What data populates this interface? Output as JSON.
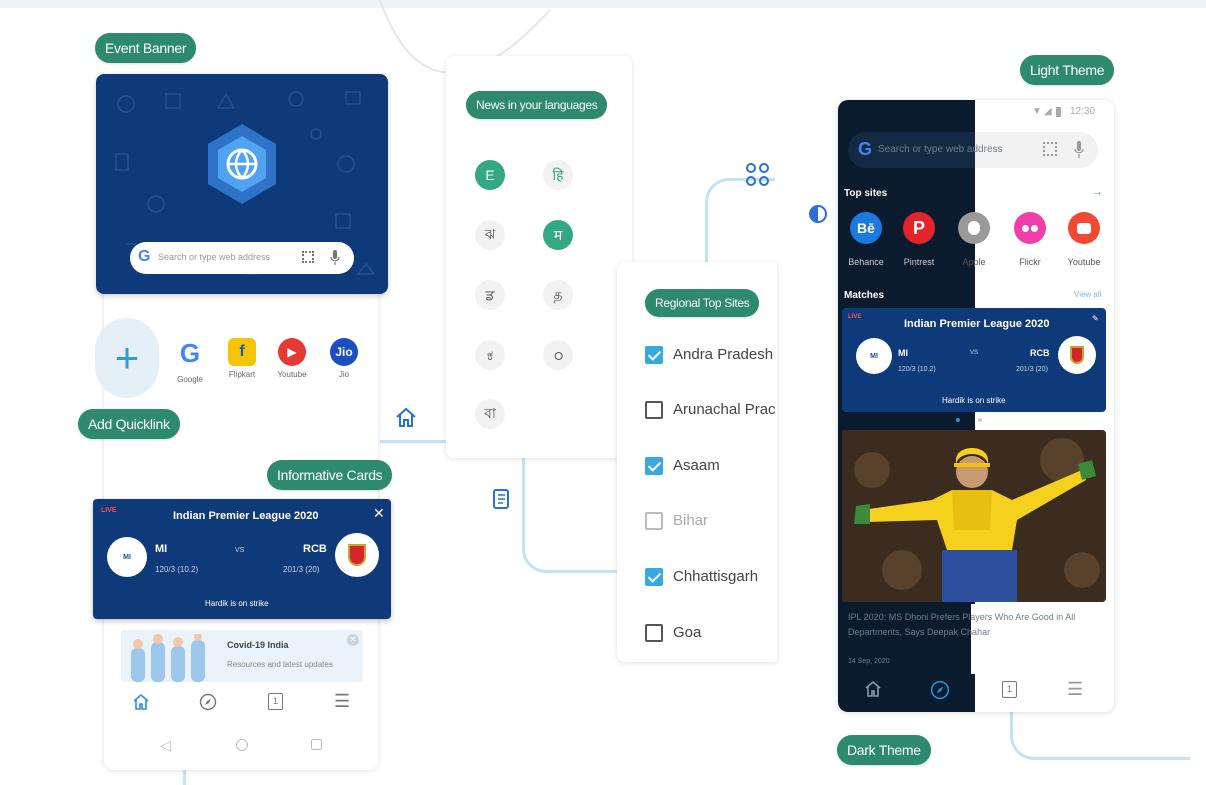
{
  "labels": {
    "event_banner": "Event Banner",
    "add_quicklink": "Add Quicklink",
    "informative_cards": "Informative Cards",
    "news_languages": "News in your languages",
    "regional_top_sites": "Regional Top Sites",
    "light_theme": "Light Theme",
    "dark_theme": "Dark Theme"
  },
  "left_phone": {
    "search_placeholder": "Search or type web address",
    "quicklinks": [
      {
        "label": "Google",
        "icon": "google-icon"
      },
      {
        "label": "Flipkart",
        "icon": "flipkart-icon"
      },
      {
        "label": "Youtube",
        "icon": "youtube-icon"
      },
      {
        "label": "Jio",
        "icon": "jio-icon"
      }
    ],
    "match": {
      "live": "LIVE",
      "title": "Indian Premier League 2020",
      "team1": "MI",
      "team1_score": "120/3 (10.2)",
      "vs": "VS",
      "team2": "RCB",
      "team2_score": "201/3 (20)",
      "status": "Hardik is on strike"
    },
    "covid": {
      "title": "Covid-19 India",
      "subtitle": "Resources and latest updates"
    }
  },
  "languages": {
    "items": [
      "E",
      "हि",
      "ঝ",
      "म",
      "ਡ",
      "த",
      "ಕ",
      "ഠ",
      "বা"
    ]
  },
  "regional": {
    "states": [
      {
        "name": "Andra Pradesh",
        "checked": true
      },
      {
        "name": "Arunachal Prac",
        "checked": false
      },
      {
        "name": "Asaam",
        "checked": true
      },
      {
        "name": "Bihar",
        "checked": false
      },
      {
        "name": "Chhattisgarh",
        "checked": true
      },
      {
        "name": "Goa",
        "checked": false
      }
    ]
  },
  "right_phone": {
    "status_time": "12:30",
    "search_placeholder": "Search or type web address",
    "top_sites_label": "Top sites",
    "sites": [
      {
        "label": "Behance",
        "icon": "behance-icon"
      },
      {
        "label": "Pintrest",
        "icon": "pinterest-icon"
      },
      {
        "label": "Apple",
        "icon": "apple-icon"
      },
      {
        "label": "Flickr",
        "icon": "flickr-icon"
      },
      {
        "label": "Youtube",
        "icon": "youtube-icon"
      }
    ],
    "matches_label": "Matches",
    "view_all": "View all",
    "match": {
      "live": "LIVE",
      "title": "Indian Premier League 2020",
      "team1": "MI",
      "team1_score": "120/3 (10.2)",
      "vs": "VS",
      "team2": "RCB",
      "team2_score": "201/3 (20)",
      "status": "Hardik is on strike"
    },
    "news": {
      "headline": "IPL 2020: MS Dhoni Prefers Players Who Are Good in All Departments, Says Deepak Chahar",
      "date": "14 Sep, 2020"
    }
  },
  "colors": {
    "pill": "#2d8a6e",
    "navy": "#0e3a7a",
    "connector": "#bfe4f5",
    "check": "#38a9e0",
    "dark_bg": "#0b1b2e"
  }
}
